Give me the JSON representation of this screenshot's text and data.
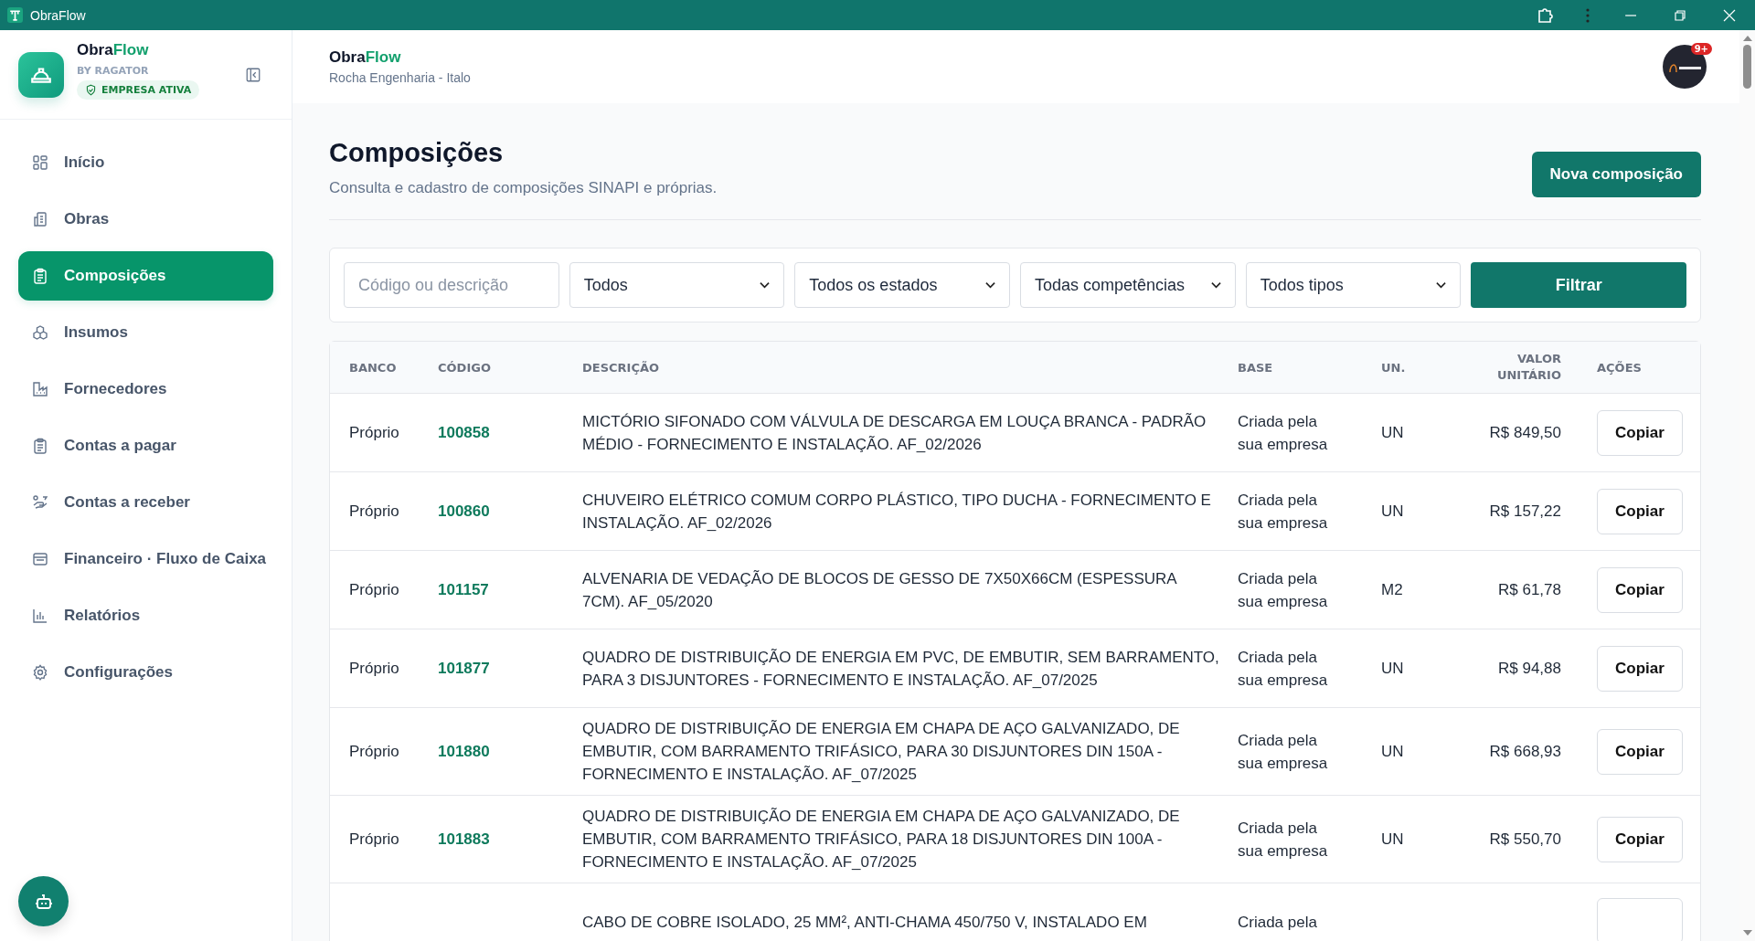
{
  "window": {
    "title": "ObraFlow"
  },
  "sidebar": {
    "brand": "Obra",
    "brand_accent": "Flow",
    "byline": "BY RAGATOR",
    "status": "EMPRESA ATIVA",
    "items": [
      {
        "label": "Início",
        "kind": "grid",
        "selected": false
      },
      {
        "label": "Obras",
        "kind": "building",
        "selected": false
      },
      {
        "label": "Composições",
        "kind": "clipboard",
        "selected": true
      },
      {
        "label": "Insumos",
        "kind": "boxes",
        "selected": false
      },
      {
        "label": "Fornecedores",
        "kind": "factory",
        "selected": false
      },
      {
        "label": "Contas a pagar",
        "kind": "clipboard",
        "selected": false
      },
      {
        "label": "Contas a receber",
        "kind": "hand",
        "selected": false
      },
      {
        "label": "Financeiro · Fluxo de Caixa",
        "kind": "wallet",
        "selected": false
      },
      {
        "label": "Relatórios",
        "kind": "chart",
        "selected": false
      },
      {
        "label": "Configurações",
        "kind": "gear",
        "selected": false
      }
    ]
  },
  "header": {
    "brand": "Obra",
    "brand_accent": "Flow",
    "subtitle": "Rocha Engenharia - Italo",
    "badge": "9+"
  },
  "page": {
    "title": "Composições",
    "subtitle": "Consulta e cadastro de composições SINAPI e próprias.",
    "primary_button": "Nova composição"
  },
  "filters": {
    "search": {
      "placeholder": "Código ou descrição"
    },
    "dropdowns": [
      "Todos",
      "Todos os estados",
      "Todas competências",
      "Todos tipos"
    ],
    "button": "Filtrar"
  },
  "table": {
    "columns": [
      "BANCO",
      "CÓDIGO",
      "DESCRIÇÃO",
      "BASE",
      "UN.",
      "VALOR UNITÁRIO",
      "AÇÕES"
    ],
    "rows": [
      {
        "banco": "Próprio",
        "codigo": "100858",
        "descricao": "MICTÓRIO SIFONADO COM VÁLVULA DE DESCARGA EM LOUÇA BRANCA - PADRÃO MÉDIO - FORNECIMENTO E INSTALAÇÃO. AF_02/2026",
        "base": "Criada pela sua empresa",
        "un": "UN",
        "valor": "R$ 849,50",
        "action": "Copiar"
      },
      {
        "banco": "Próprio",
        "codigo": "100860",
        "descricao": "CHUVEIRO ELÉTRICO COMUM CORPO PLÁSTICO, TIPO DUCHA - FORNECIMENTO E INSTALAÇÃO. AF_02/2026",
        "base": "Criada pela sua empresa",
        "un": "UN",
        "valor": "R$ 157,22",
        "action": "Copiar"
      },
      {
        "banco": "Próprio",
        "codigo": "101157",
        "descricao": "ALVENARIA DE VEDAÇÃO DE BLOCOS DE GESSO DE 7X50X66CM (ESPESSURA 7CM). AF_05/2020",
        "base": "Criada pela sua empresa",
        "un": "M2",
        "valor": "R$ 61,78",
        "action": "Copiar"
      },
      {
        "banco": "Próprio",
        "codigo": "101877",
        "descricao": "QUADRO DE DISTRIBUIÇÃO DE ENERGIA EM PVC, DE EMBUTIR, SEM BARRAMENTO, PARA 3 DISJUNTORES - FORNECIMENTO E INSTALAÇÃO. AF_07/2025",
        "base": "Criada pela sua empresa",
        "un": "UN",
        "valor": "R$ 94,88",
        "action": "Copiar"
      },
      {
        "banco": "Próprio",
        "codigo": "101880",
        "descricao": "QUADRO DE DISTRIBUIÇÃO DE ENERGIA EM CHAPA DE AÇO GALVANIZADO, DE EMBUTIR, COM BARRAMENTO TRIFÁSICO, PARA 30 DISJUNTORES DIN 150A - FORNECIMENTO E INSTALAÇÃO. AF_07/2025",
        "base": "Criada pela sua empresa",
        "un": "UN",
        "valor": "R$ 668,93",
        "action": "Copiar"
      },
      {
        "banco": "Próprio",
        "codigo": "101883",
        "descricao": "QUADRO DE DISTRIBUIÇÃO DE ENERGIA EM CHAPA DE AÇO GALVANIZADO, DE EMBUTIR, COM BARRAMENTO TRIFÁSICO, PARA 18 DISJUNTORES DIN 100A - FORNECIMENTO E INSTALAÇÃO. AF_07/2025",
        "base": "Criada pela sua empresa",
        "un": "UN",
        "valor": "R$ 550,70",
        "action": "Copiar"
      },
      {
        "descricao": "CABO DE COBRE ISOLADO, 25 MM², ANTI-CHAMA 450/750 V, INSTALADO EM",
        "base": "Criada pela"
      }
    ]
  }
}
